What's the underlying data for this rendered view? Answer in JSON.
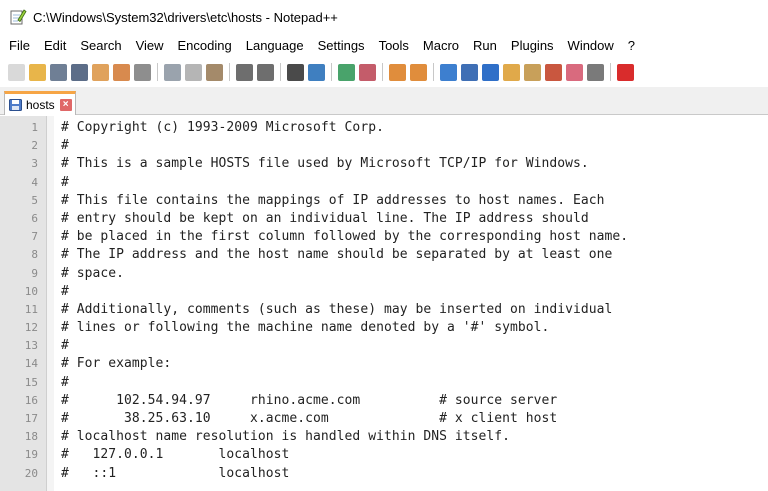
{
  "window": {
    "title": "C:\\Windows\\System32\\drivers\\etc\\hosts - Notepad++",
    "icon": "notepad-pen-icon"
  },
  "menu": [
    "File",
    "Edit",
    "Search",
    "View",
    "Encoding",
    "Language",
    "Settings",
    "Tools",
    "Macro",
    "Run",
    "Plugins",
    "Window",
    "?"
  ],
  "toolbar": {
    "groups": [
      [
        {
          "name": "new-file-icon",
          "color": "#d9d9d9",
          "glyph": ""
        },
        {
          "name": "open-file-icon",
          "color": "#e8b54a",
          "glyph": ""
        },
        {
          "name": "save-icon",
          "color": "#6f7f95",
          "glyph": ""
        },
        {
          "name": "save-all-icon",
          "color": "#5c6d88",
          "glyph": ""
        },
        {
          "name": "close-file-icon",
          "color": "#e0a25c",
          "glyph": ""
        },
        {
          "name": "close-all-icon",
          "color": "#d88a4e",
          "glyph": ""
        },
        {
          "name": "print-icon",
          "color": "#8e8e8e",
          "glyph": ""
        }
      ],
      [
        {
          "name": "cut-icon",
          "color": "#9aa3ad",
          "glyph": ""
        },
        {
          "name": "copy-icon",
          "color": "#b5b5b5",
          "glyph": ""
        },
        {
          "name": "paste-icon",
          "color": "#a48a6a",
          "glyph": ""
        }
      ],
      [
        {
          "name": "undo-icon",
          "color": "#6e6e6e",
          "glyph": ""
        },
        {
          "name": "redo-icon",
          "color": "#6e6e6e",
          "glyph": ""
        }
      ],
      [
        {
          "name": "find-icon",
          "color": "#4a4a4a",
          "glyph": ""
        },
        {
          "name": "replace-icon",
          "color": "#3f7fc0",
          "glyph": ""
        }
      ],
      [
        {
          "name": "zoom-in-icon",
          "color": "#49a36b",
          "glyph": ""
        },
        {
          "name": "zoom-out-icon",
          "color": "#c45c6a",
          "glyph": ""
        }
      ],
      [
        {
          "name": "sync-vertical-icon",
          "color": "#e08d3c",
          "glyph": ""
        },
        {
          "name": "sync-horizontal-icon",
          "color": "#e08d3c",
          "glyph": ""
        }
      ],
      [
        {
          "name": "word-wrap-icon",
          "color": "#3d7fcf",
          "glyph": ""
        },
        {
          "name": "show-all-characters-icon",
          "color": "#3f6fb5",
          "glyph": ""
        },
        {
          "name": "indent-guide-icon",
          "color": "#2f6fc8",
          "glyph": ""
        },
        {
          "name": "user-defined-language-icon",
          "color": "#e0a94a",
          "glyph": ""
        },
        {
          "name": "document-map-icon",
          "color": "#c8a05a",
          "glyph": ""
        },
        {
          "name": "function-list-icon",
          "color": "#c9573f",
          "glyph": ""
        },
        {
          "name": "folder-as-workspace-icon",
          "color": "#d96a7e",
          "glyph": ""
        },
        {
          "name": "monitoring-icon",
          "color": "#7a7a7a",
          "glyph": ""
        }
      ],
      [
        {
          "name": "record-macro-icon",
          "color": "#d92c2c",
          "glyph": ""
        }
      ]
    ]
  },
  "tabs": [
    {
      "label": "hosts",
      "icon": "save-disk-icon",
      "close": "close-tab-icon"
    }
  ],
  "editor": {
    "lines": [
      {
        "n": "1",
        "text": "# Copyright (c) 1993-2009 Microsoft Corp."
      },
      {
        "n": "2",
        "text": "#"
      },
      {
        "n": "3",
        "text": "# This is a sample HOSTS file used by Microsoft TCP/IP for Windows."
      },
      {
        "n": "4",
        "text": "#"
      },
      {
        "n": "5",
        "text": "# This file contains the mappings of IP addresses to host names. Each"
      },
      {
        "n": "6",
        "text": "# entry should be kept on an individual line. The IP address should"
      },
      {
        "n": "7",
        "text": "# be placed in the first column followed by the corresponding host name."
      },
      {
        "n": "8",
        "text": "# The IP address and the host name should be separated by at least one"
      },
      {
        "n": "9",
        "text": "# space."
      },
      {
        "n": "10",
        "text": "#"
      },
      {
        "n": "11",
        "text": "# Additionally, comments (such as these) may be inserted on individual"
      },
      {
        "n": "12",
        "text": "# lines or following the machine name denoted by a '#' symbol."
      },
      {
        "n": "13",
        "text": "#"
      },
      {
        "n": "14",
        "text": "# For example:"
      },
      {
        "n": "15",
        "text": "#"
      },
      {
        "n": "16",
        "text": "#      102.54.94.97     rhino.acme.com          # source server"
      },
      {
        "n": "17",
        "text": "#       38.25.63.10     x.acme.com              # x client host"
      },
      {
        "n": "18",
        "text": "# localhost name resolution is handled within DNS itself."
      },
      {
        "n": "19",
        "text": "#   127.0.0.1       localhost"
      },
      {
        "n": "20",
        "text": "#   ::1             localhost"
      }
    ]
  }
}
